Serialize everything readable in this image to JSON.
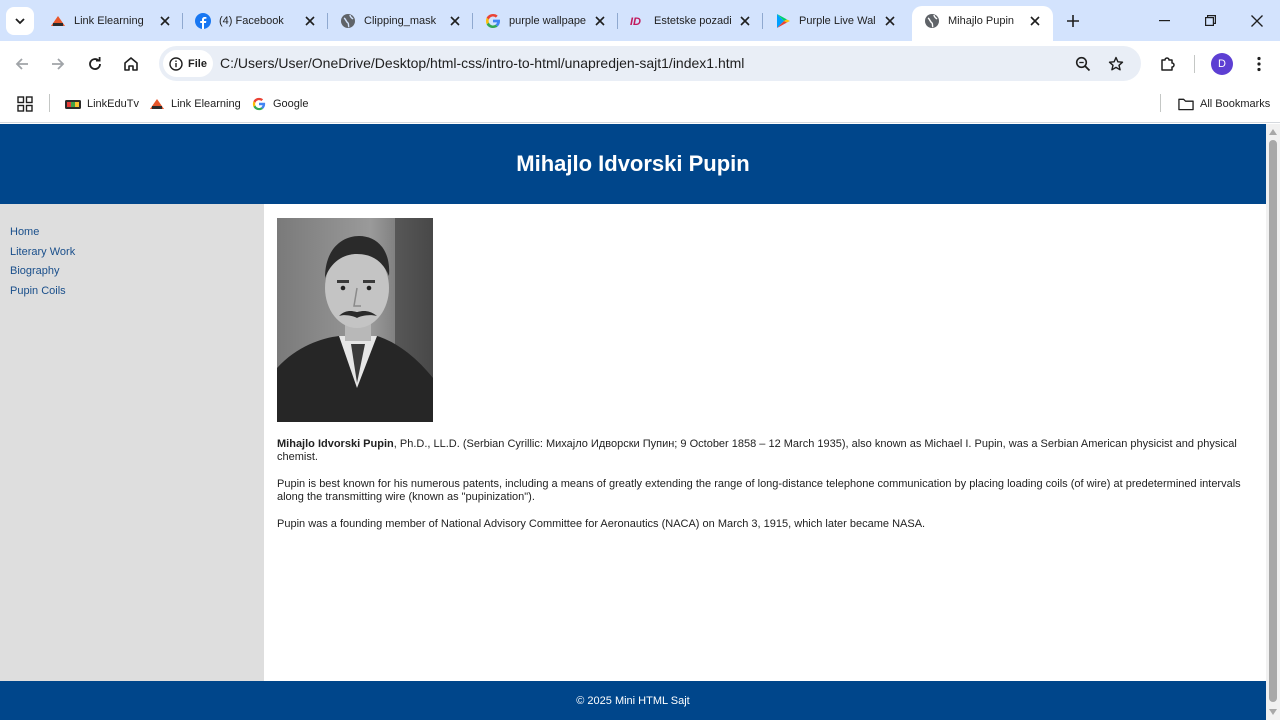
{
  "browser": {
    "tabs": [
      {
        "title": "Link Elearning",
        "icon": "link-elearning-icon"
      },
      {
        "title": "(4) Facebook",
        "icon": "facebook-icon"
      },
      {
        "title": "Clipping_mask",
        "icon": "globe-icon"
      },
      {
        "title": "purple wallpaper",
        "icon": "google-icon"
      },
      {
        "title": "Estetske pozadine",
        "icon": "estetske-icon"
      },
      {
        "title": "Purple Live Wallpapers",
        "icon": "play-store-icon"
      },
      {
        "title": "Mihajlo Pupin",
        "icon": "globe-icon"
      }
    ],
    "active_tab_index": 6,
    "address": {
      "chip_label": "File",
      "url": "C:/Users/User/OneDrive/Desktop/html-css/intro-to-html/unapredjen-sajt1/index1.html"
    },
    "profile_initial": "D",
    "bookmarks": [
      {
        "label": "LinkEduTv"
      },
      {
        "label": "Link Elearning"
      },
      {
        "label": "Google"
      }
    ],
    "all_bookmarks_label": "All Bookmarks"
  },
  "site": {
    "header_title": "Mihajlo Idvorski Pupin",
    "nav": [
      "Home",
      "Literary Work",
      "Biography",
      "Pupin Coils"
    ],
    "intro_bold": "Mihajlo Idvorski Pupin",
    "intro_rest": ", Ph.D., LL.D. (Serbian Cyrillic: Михајло Идворски Пупин; 9 October 1858 – 12 March 1935), also known as Michael I. Pupin, was a Serbian American physicist and physical chemist.",
    "paragraph2": "Pupin is best known for his numerous patents, including a means of greatly extending the range of long-distance telephone communication by placing loading coils (of wire) at predetermined intervals along the transmitting wire (known as \"pupinization\").",
    "paragraph3": "Pupin was a founding member of National Advisory Committee for Aeronautics (NACA) on March 3, 1915, which later became NASA.",
    "footer": "© 2025 Mini HTML Sajt"
  },
  "colors": {
    "header_bg": "#00468b",
    "sidebar_bg": "#dedede",
    "tabstrip_bg": "#d3e3fd",
    "link": "#1a4f8b"
  }
}
